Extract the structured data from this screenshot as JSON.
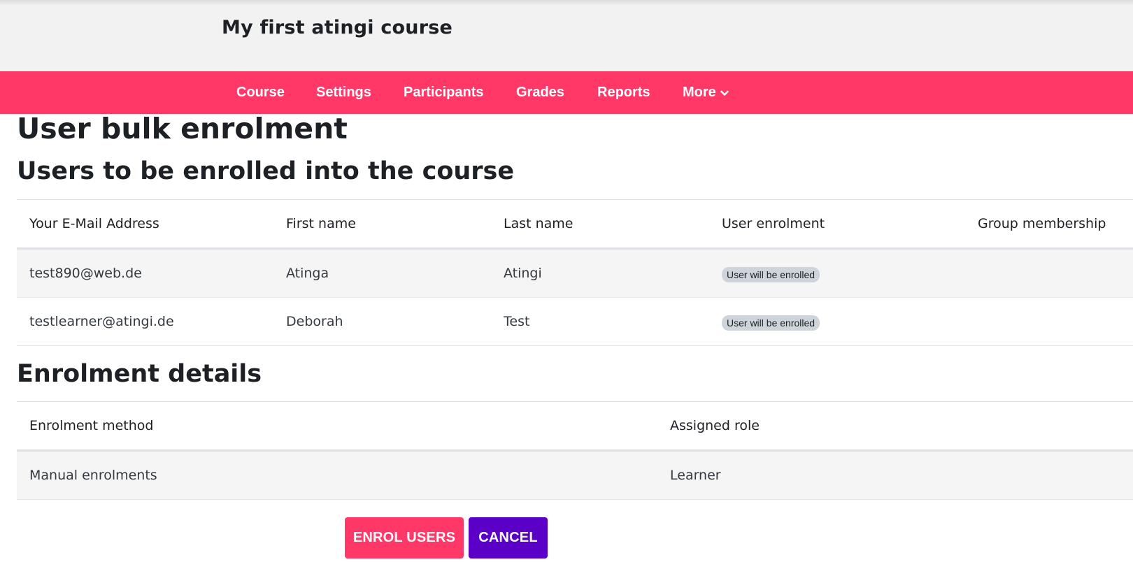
{
  "header": {
    "course_title": "My first atingi course"
  },
  "nav": {
    "items": [
      {
        "label": "Course"
      },
      {
        "label": "Settings"
      },
      {
        "label": "Participants"
      },
      {
        "label": "Grades"
      },
      {
        "label": "Reports"
      },
      {
        "label": "More",
        "icon": "chevron-down-icon"
      }
    ]
  },
  "page": {
    "title": "User bulk enrolment",
    "users_section_title": "Users to be enrolled into the course",
    "details_section_title": "Enrolment details"
  },
  "users_table": {
    "columns": [
      "Your E-Mail Address",
      "First name",
      "Last name",
      "User enrolment",
      "Group membership"
    ],
    "rows": [
      {
        "email": "test890@web.de",
        "first_name": "Atinga",
        "last_name": "Atingi",
        "enrolment": "User will be enrolled",
        "group": ""
      },
      {
        "email": "testlearner@atingi.de",
        "first_name": "Deborah",
        "last_name": "Test",
        "enrolment": "User will be enrolled",
        "group": ""
      }
    ]
  },
  "details_table": {
    "columns": [
      "Enrolment method",
      "Assigned role"
    ],
    "rows": [
      {
        "method": "Manual enrolments",
        "role": "Learner"
      }
    ]
  },
  "buttons": {
    "enrol": "ENROL USERS",
    "cancel": "CANCEL"
  },
  "colors": {
    "brand": "#ff3868",
    "cancel": "#5a00c7",
    "badge_bg": "#ced4da"
  }
}
